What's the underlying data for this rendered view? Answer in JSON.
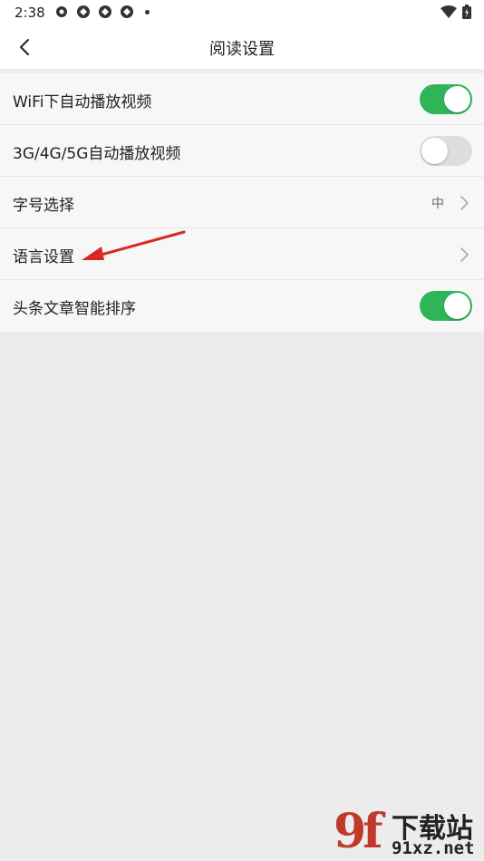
{
  "status_bar": {
    "time": "2:38"
  },
  "header": {
    "title": "阅读设置"
  },
  "settings": [
    {
      "label": "WiFi下自动播放视频",
      "type": "toggle",
      "state": "on"
    },
    {
      "label": "3G/4G/5G自动播放视频",
      "type": "toggle",
      "state": "off"
    },
    {
      "label": "字号选择",
      "type": "nav",
      "value": "中"
    },
    {
      "label": "语言设置",
      "type": "nav",
      "value": ""
    },
    {
      "label": "头条文章智能排序",
      "type": "toggle",
      "state": "on"
    }
  ],
  "colors": {
    "toggle_on": "#2fb557",
    "toggle_off": "#dddddd",
    "annotation_arrow": "#d42a22"
  },
  "watermark": {
    "logo": "9f",
    "top": "下载站",
    "bottom": "91xz.net"
  }
}
